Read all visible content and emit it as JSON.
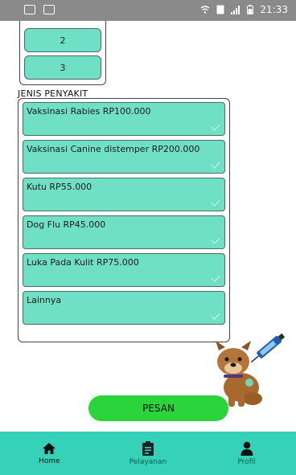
{
  "status_bar": {
    "time": "21:33"
  },
  "quantity": {
    "options": [
      "2",
      "3"
    ]
  },
  "disease_section": {
    "label": "JENIS PENYAKIT",
    "items": [
      "Vaksinasi Rabies RP100.000",
      "Vaksinasi Canine distemper RP200.000",
      "Kutu RP55.000",
      "Dog Flu RP45.000",
      "Luka Pada Kulit RP75.000",
      "Lainnya"
    ]
  },
  "order_button": {
    "label": "PESAN"
  },
  "bottom_nav": {
    "items": [
      {
        "label": "Home",
        "icon": "home-icon",
        "active": true
      },
      {
        "label": "Pelayanan",
        "icon": "clipboard-icon",
        "active": false
      },
      {
        "label": "Profil",
        "icon": "user-icon",
        "active": false
      }
    ]
  },
  "colors": {
    "status_bar": "#8a8a8a",
    "option_fill": "#6fe0c6",
    "order_button": "#2ad43a",
    "nav_bar": "#36d1b9"
  }
}
